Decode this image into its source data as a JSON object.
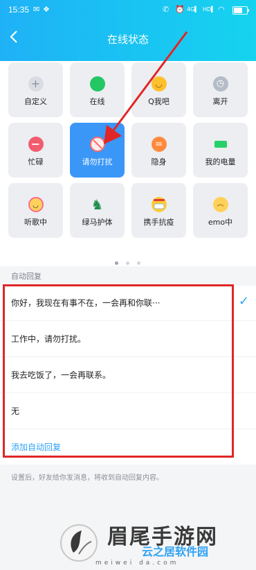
{
  "status_bar": {
    "time": "15:35",
    "icons": [
      "phone-icon",
      "alarm-icon",
      "signal-4g-icon",
      "signal-hd-icon",
      "wifi-icon",
      "battery-icon"
    ],
    "battery_level": 0.65
  },
  "header": {
    "title": "在线状态"
  },
  "status_tiles": [
    {
      "label": "自定义",
      "icon": "plus-icon",
      "color": "#9aa1ad"
    },
    {
      "label": "在线",
      "icon": "online-dot-icon",
      "color": "#23c764"
    },
    {
      "label": "Q我吧",
      "icon": "smile-icon",
      "color": "#ffc02e"
    },
    {
      "label": "离开",
      "icon": "clock-icon",
      "color": "#b5bcc7"
    },
    {
      "label": "忙碌",
      "icon": "busy-minus-icon",
      "color": "#f25c6f"
    },
    {
      "label": "请勿打扰",
      "icon": "do-not-disturb-icon",
      "color": "#ff6b6b",
      "selected": true
    },
    {
      "label": "隐身",
      "icon": "invisible-icon",
      "color": "#ff8a3d"
    },
    {
      "label": "我的电量",
      "icon": "battery-status-icon",
      "color": "#27d06a"
    },
    {
      "label": "听歌中",
      "icon": "headphone-face-icon",
      "color": "#ff6b8c"
    },
    {
      "label": "绿马护体",
      "icon": "green-horse-icon",
      "color": "#1f8f4a"
    },
    {
      "label": "携手抗疫",
      "icon": "mask-face-icon",
      "color": "#ffcc33"
    },
    {
      "label": "emo中",
      "icon": "sad-face-icon",
      "color": "#ffd15a"
    }
  ],
  "pager": {
    "count": 3,
    "active": 0
  },
  "auto_reply": {
    "section_title": "自动回复",
    "options": [
      {
        "text": "你好，我现在有事不在，一会再和你联···",
        "checked": true
      },
      {
        "text": "工作中，请勿打扰。"
      },
      {
        "text": "我去吃饭了，一会再联系。"
      },
      {
        "text": "无"
      }
    ],
    "add_label": "添加自动回复",
    "hint": "设置后，好友给你发消息，将收到自动回复内容。"
  },
  "watermark": {
    "main": "眉尾手游网",
    "sub": "meiwei da.com",
    "second": "云之居软件园"
  }
}
